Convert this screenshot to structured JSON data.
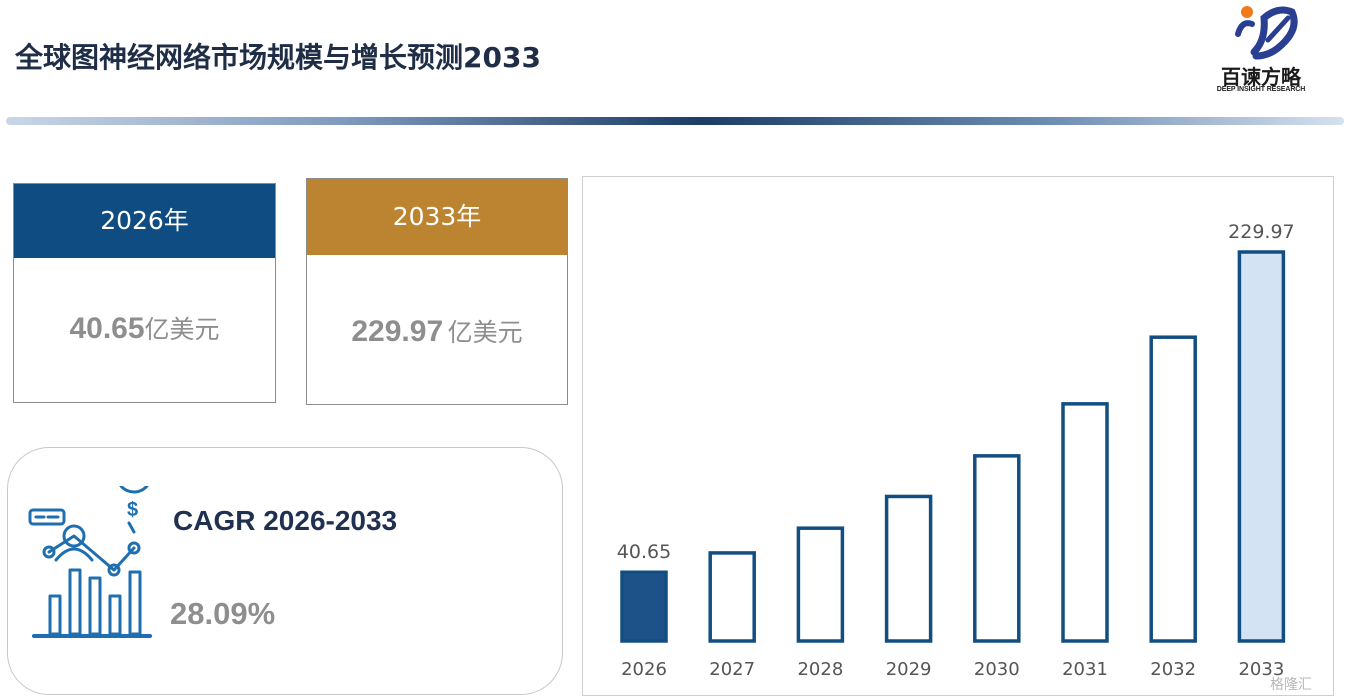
{
  "header": {
    "title": "全球图神经网络市场规模与增长预测2033",
    "logo_cn": "百谏方略",
    "logo_en": "DEEP INSIGHT RESEARCH"
  },
  "cards": [
    {
      "year_label": "2026年",
      "value": "40.65",
      "unit": "亿美元",
      "color": "#0e4c81"
    },
    {
      "year_label": "2033年",
      "value": "229.97",
      "unit": "亿美元",
      "color": "#bc8430"
    }
  ],
  "cagr": {
    "label": "CAGR 2026-2033",
    "value": "28.09%",
    "icon": "growth-chart-icon"
  },
  "watermark": "格隆汇",
  "colors": {
    "primary": "#0e4c81",
    "accent": "#bc8430",
    "bar_outline": "#124e80",
    "highlight_fill": "#d4e3f4"
  },
  "chart_data": {
    "type": "bar",
    "categories": [
      "2026",
      "2027",
      "2028",
      "2029",
      "2030",
      "2031",
      "2032",
      "2033"
    ],
    "values": [
      40.65,
      52.07,
      66.7,
      85.45,
      109.45,
      140.2,
      179.6,
      229.97
    ],
    "data_labels": {
      "2026": "40.65",
      "2033": "229.97"
    },
    "title": "",
    "xlabel": "",
    "ylabel": "",
    "ylim": [
      0,
      250
    ],
    "grid": false,
    "legend": "none"
  }
}
